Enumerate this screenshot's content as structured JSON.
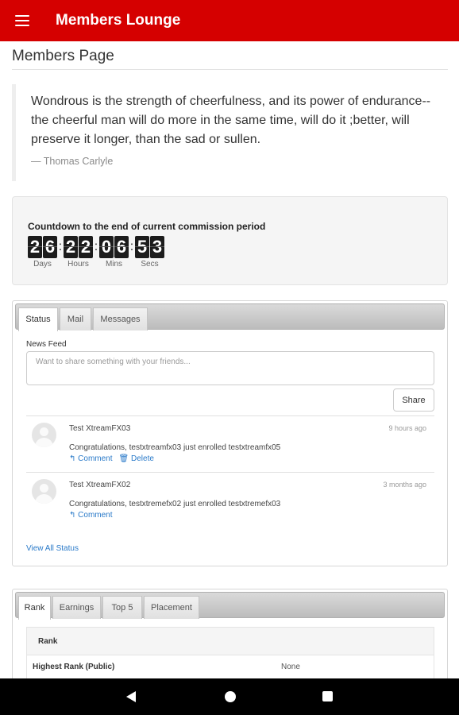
{
  "app_bar": {
    "title": "Members Lounge",
    "icon": "hamburger-menu-icon",
    "color": "#d50000"
  },
  "page": {
    "title": "Members Page"
  },
  "quote": {
    "text": "Wondrous is the strength of cheerfulness, and its power of endurance--the cheerful man will do more in the same time, will do it ;better, will preserve it longer, than the sad or sullen.",
    "author": "— Thomas Carlyle"
  },
  "countdown": {
    "title": "Countdown to the end of current commission period",
    "units": [
      {
        "digits": [
          "2",
          "6"
        ],
        "label": "Days"
      },
      {
        "digits": [
          "2",
          "2"
        ],
        "label": "Hours"
      },
      {
        "digits": [
          "0",
          "6"
        ],
        "label": "Mins"
      },
      {
        "digits": [
          "5",
          "3"
        ],
        "label": "Secs"
      }
    ],
    "separator": ":"
  },
  "status_panel": {
    "tabs": [
      "Status",
      "Mail",
      "Messages"
    ],
    "active_tab": "Status",
    "news_feed_label": "News Feed",
    "input_placeholder": "Want to share something with your friends...",
    "share_label": "Share",
    "items": [
      {
        "name": "Test XtreamFX03",
        "time": "9 hours ago",
        "text": "Congratulations, testxtreamfx03 just enrolled testxtreamfx05",
        "comment_label": "Comment",
        "delete_label": "Delete"
      },
      {
        "name": "Test XtreamFX02",
        "time": "3 months ago",
        "text": "Congratulations, testxtremefx02 just enrolled testxtremefx03",
        "comment_label": "Comment"
      }
    ],
    "view_all_label": "View All Status"
  },
  "rank_panel": {
    "tabs": [
      "Rank",
      "Earnings",
      "Top 5",
      "Placement"
    ],
    "active_tab": "Rank",
    "table_header": "Rank",
    "rows": [
      {
        "key": "Highest Rank (Public)",
        "value": "None"
      }
    ]
  },
  "system_nav": {
    "icons": [
      "back-icon",
      "home-icon",
      "recents-icon"
    ]
  }
}
